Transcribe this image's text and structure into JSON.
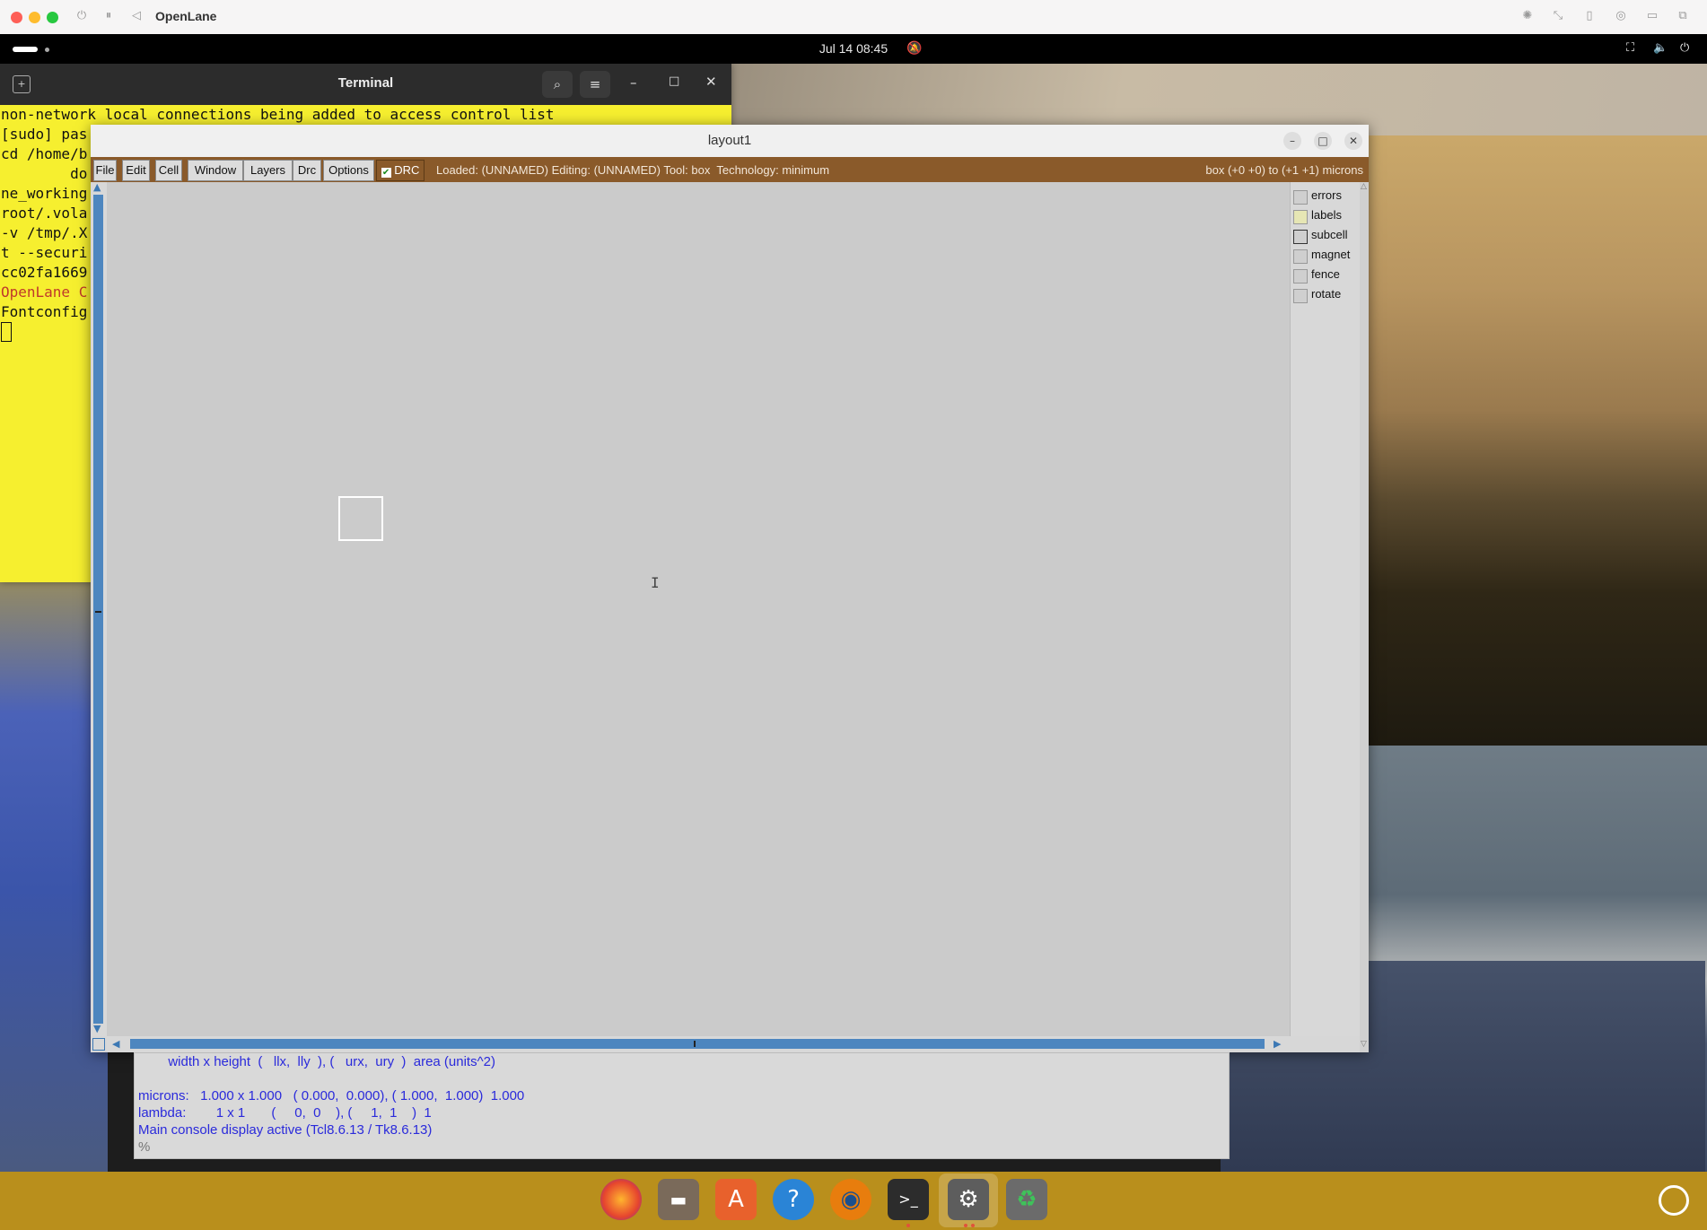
{
  "host": {
    "title": "OpenLane",
    "traffic_colors": [
      "#fe5f57",
      "#febc2e",
      "#28c840"
    ]
  },
  "panel": {
    "clock": "Jul 14  08:45"
  },
  "terminal": {
    "title": "Terminal",
    "lines": [
      "non-network local connections being added to access control list",
      "[sudo] pas",
      "cd /home/b",
      "        do",
      "ne_working",
      "root/.vola",
      "-v /tmp/.X",
      "t --securi",
      "cc02fa1669",
      "OpenLane C",
      "Fontconfig"
    ],
    "highlight_line_color": "#c0392b"
  },
  "layout": {
    "title": "layout1",
    "menus": [
      "File",
      "Edit",
      "Cell",
      "Window",
      "Layers",
      "Drc",
      "Options"
    ],
    "drc_label": "DRC",
    "drc_checked": true,
    "status": "Loaded: (UNNAMED) Editing: (UNNAMED) Tool: box  Technology: minimum",
    "box_info": "box (+0 +0) to (+1 +1) microns",
    "layers": [
      "errors",
      "labels",
      "subcell",
      "magnet",
      "fence",
      "rotate"
    ]
  },
  "console": {
    "lines": [
      "        width x height  (   llx,  lly  ), (   urx,  ury  )  area (units^2)",
      "",
      "microns:   1.000 x 1.000   ( 0.000,  0.000), ( 1.000,  1.000)  1.000",
      "lambda:        1 x 1       (     0,  0    ), (     1,  1    )  1",
      "Main console display active (Tcl8.6.13 / Tk8.6.13)"
    ],
    "prompt": "%"
  },
  "dock": {
    "apps": [
      "firefox-icon",
      "files-icon",
      "app-center-icon",
      "help-icon",
      "blender-icon",
      "terminal-icon",
      "settings-icon",
      "trash-icon"
    ]
  }
}
